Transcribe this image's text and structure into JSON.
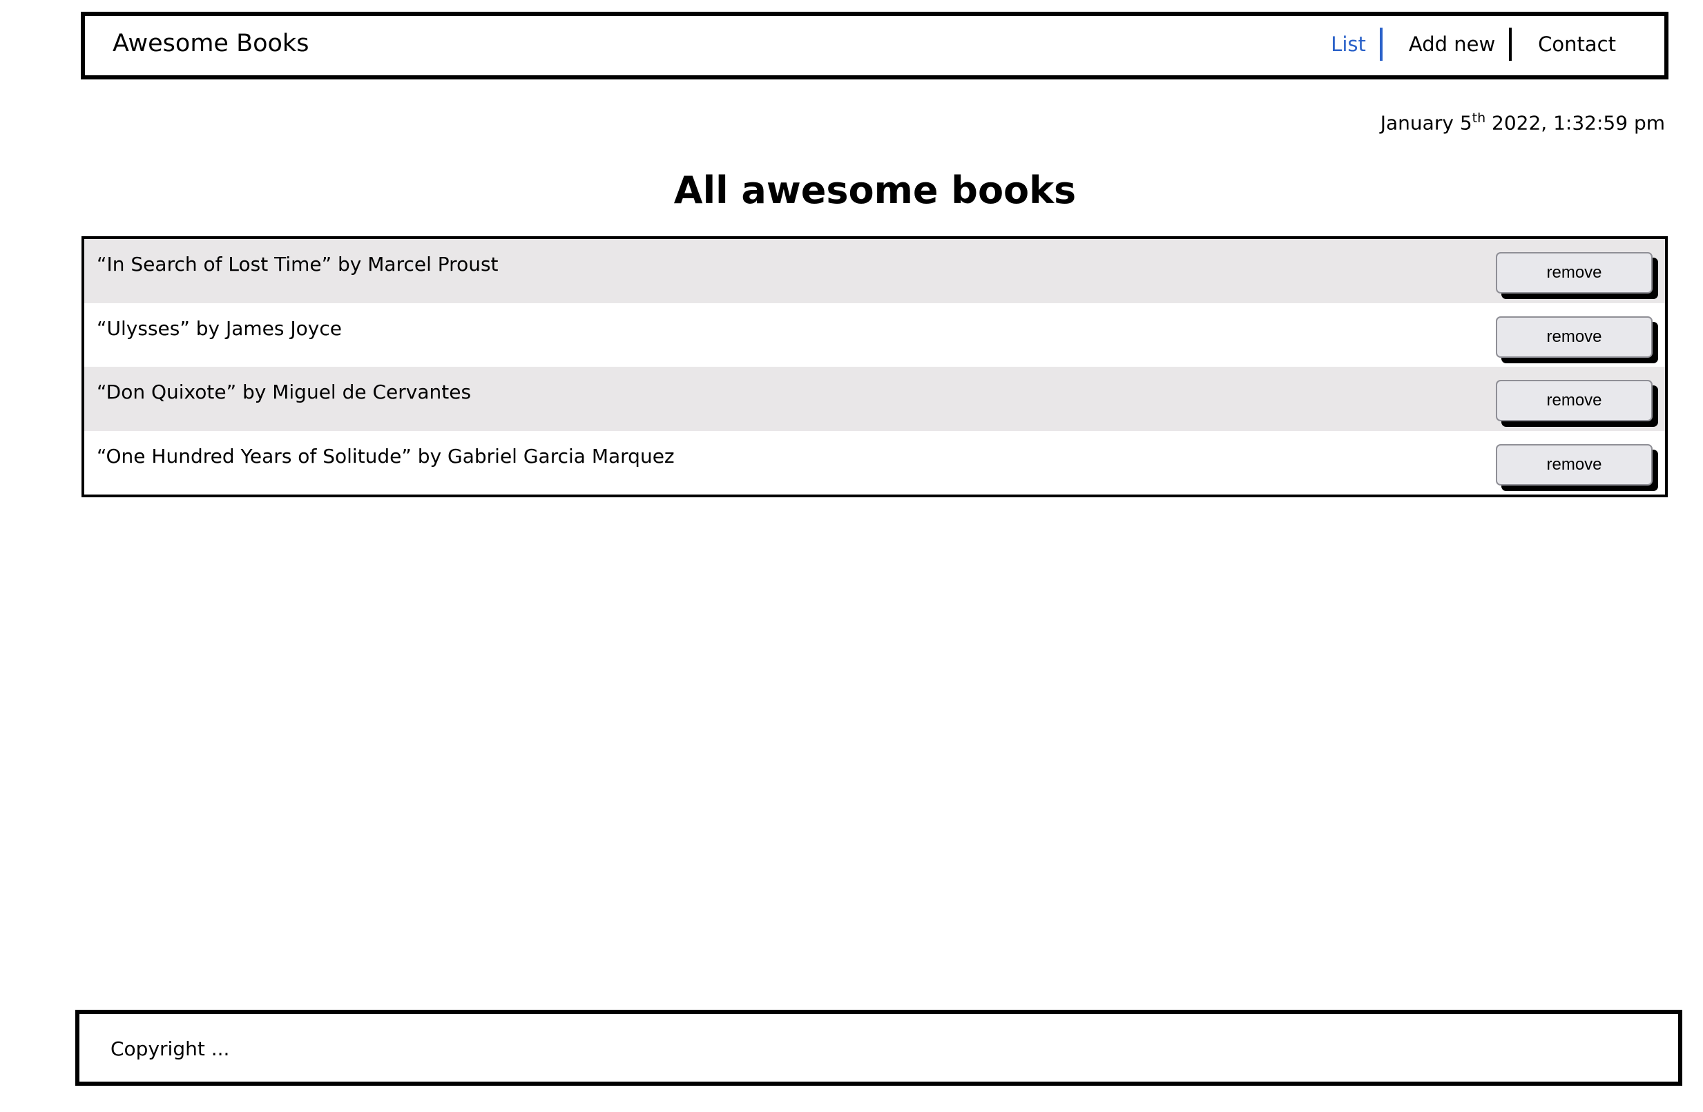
{
  "header": {
    "brand": "Awesome Books",
    "nav": [
      {
        "label": "List",
        "active": true
      },
      {
        "label": "Add new"
      },
      {
        "label": "Contact"
      }
    ]
  },
  "date": {
    "prefix": "January 5",
    "suffix": "th",
    "rest": " 2022, 1:32:59 pm"
  },
  "main": {
    "title": "All awesome books",
    "books": [
      {
        "text": "“In Search of Lost Time” by Marcel Proust",
        "button": "remove"
      },
      {
        "text": "“Ulysses” by James Joyce",
        "button": "remove"
      },
      {
        "text": "“Don Quixote” by Miguel de Cervantes",
        "button": "remove"
      },
      {
        "text": "“One Hundred Years of Solitude” by Gabriel Garcia Marquez",
        "button": "remove"
      }
    ]
  },
  "footer": {
    "text": "Copyright ..."
  },
  "colors": {
    "accent": "#2b62c9",
    "row_alt": "#e9e7e8"
  }
}
